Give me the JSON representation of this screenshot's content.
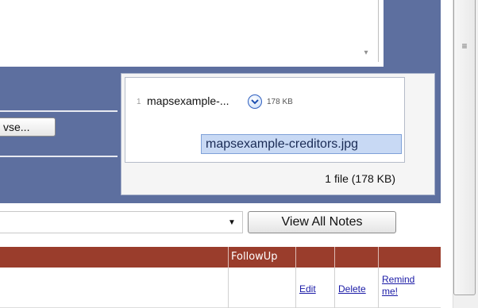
{
  "textarea": {
    "scroll_glyph": "▾"
  },
  "upload": {
    "browse_label": "vse...",
    "file_index": "1",
    "file_name": "mapsexample-...",
    "file_size": "178 KB",
    "tooltip": "mapsexample-creditors.jpg",
    "summary": "1 file (178 KB)"
  },
  "notes": {
    "select_arrow": "▼",
    "view_all_label": "View All Notes"
  },
  "table": {
    "followup_header": "FollowUp",
    "edit_link": "Edit",
    "delete_link": "Delete",
    "remind_link": "Remind me!"
  },
  "scrollbar": {
    "grip_glyph": "≡"
  },
  "colors": {
    "panel_blue": "#5d6f9f",
    "table_header_red": "#9a3d2c",
    "tooltip_bg": "#c8d9f4",
    "link_blue": "#1a1aa6"
  }
}
